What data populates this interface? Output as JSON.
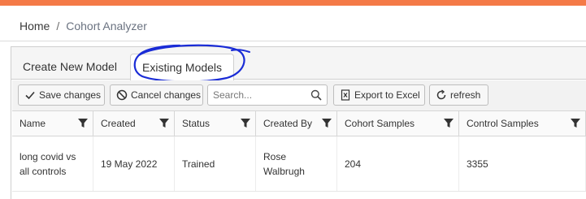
{
  "breadcrumb": {
    "home": "Home",
    "separator": "/",
    "current": "Cohort Analyzer"
  },
  "tabs": [
    {
      "label": "Create New Model",
      "active": false
    },
    {
      "label": "Existing Models",
      "active": true
    }
  ],
  "toolbar": {
    "save_label": "Save changes",
    "cancel_label": "Cancel changes",
    "search_placeholder": "Search...",
    "export_label": "Export to Excel",
    "refresh_label": "refresh"
  },
  "table": {
    "columns": [
      "Name",
      "Created",
      "Status",
      "Created By",
      "Cohort Samples",
      "Control Samples"
    ],
    "rows": [
      [
        "long covid vs all controls",
        "19 May 2022",
        "Trained",
        "Rose Walbrugh",
        "204",
        "3355"
      ]
    ]
  },
  "colors": {
    "accent": "#f47a47",
    "annotation": "#1a2cd6"
  },
  "icons": [
    "check-icon",
    "cancel-icon",
    "search-icon",
    "excel-icon",
    "refresh-icon",
    "filter-icon"
  ]
}
